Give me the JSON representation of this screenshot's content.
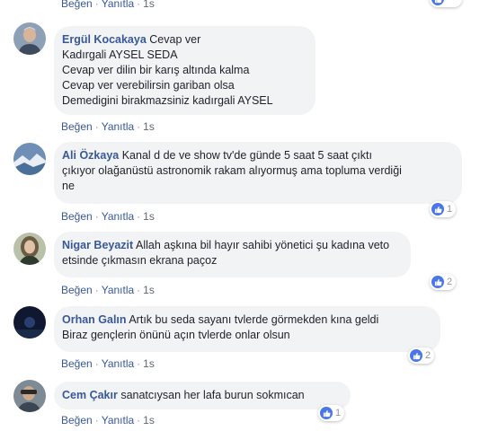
{
  "ui": {
    "like": "Beğen",
    "reply": "Yanıtla",
    "sep": "·",
    "like_icon": "thumbs-up-icon",
    "like_color": "#4a76e8"
  },
  "top_actions": {
    "time": "1s"
  },
  "comments": [
    {
      "author": "Ergül Kocakaya",
      "lines": [
        "Cevap ver",
        "Kadırgali AYSEL SEDA",
        "Cevap ver dilin bir karış altında kalma",
        "Cevap ver verebilirsin gariban olsa",
        "Demedigini birakmazsiniz kadırgali AYSEL"
      ],
      "time": "1s"
    },
    {
      "author": "Ali Özkaya",
      "lines": [
        "Kanal d de ve show tv'de günde 5 saat 5 saat çıktı",
        "çıkıyor olağanüstü astronomik rakam alıyormuş ama topluma verdiği",
        "ne"
      ],
      "time": "1s",
      "likes": "1"
    },
    {
      "author": "Nigar Beyazit",
      "lines": [
        "Allah aşkına bil hayır sahibi yönetici şu kadına veto",
        "etsinde çıkmasın ekrana paçoz"
      ],
      "time": "1s",
      "likes": "2"
    },
    {
      "author": "Orhan Galın",
      "lines": [
        "Artık bu seda sayanı tvlerde görmekden kına geldi",
        "Biraz gençlerin önünü açın tvlerde onlar olsun"
      ],
      "time": "1s",
      "likes": "2"
    },
    {
      "author": "Cem Çakır",
      "lines": [
        "sanatcıysan her lafa burun sokmıcan"
      ],
      "time": "1s",
      "likes": "1"
    }
  ]
}
